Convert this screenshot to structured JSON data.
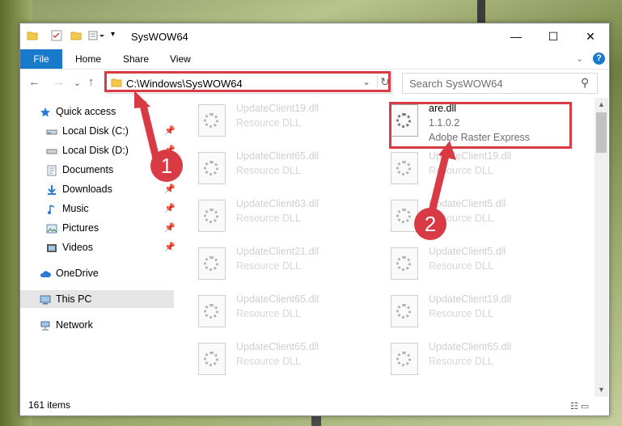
{
  "window": {
    "title": "SysWOW64",
    "minimize_glyph": "—",
    "maximize_glyph": "☐",
    "close_glyph": "✕"
  },
  "ribbon": {
    "tabs": [
      "File",
      "Home",
      "Share",
      "View"
    ],
    "help": "?",
    "collapse": "⌄"
  },
  "nav": {
    "back": "←",
    "forward": "→",
    "recent": "⌄",
    "up": "↑",
    "address": "C:\\Windows\\SysWOW64",
    "address_dropdown": "⌄",
    "refresh": "↻",
    "search_placeholder": "Search SysWOW64",
    "search_icon": "⚲"
  },
  "sidebar": {
    "items": [
      {
        "label": "Quick access",
        "icon": "star-icon",
        "pinned": false
      },
      {
        "label": "Local Disk (C:)",
        "icon": "drive-icon",
        "pinned": true
      },
      {
        "label": "Local Disk (D:)",
        "icon": "drive-icon",
        "pinned": true
      },
      {
        "label": "Documents",
        "icon": "documents-icon",
        "pinned": true
      },
      {
        "label": "Downloads",
        "icon": "download-icon",
        "pinned": true
      },
      {
        "label": "Music",
        "icon": "music-icon",
        "pinned": true
      },
      {
        "label": "Pictures",
        "icon": "pictures-icon",
        "pinned": true
      },
      {
        "label": "Videos",
        "icon": "videos-icon",
        "pinned": true
      },
      {
        "label": "OneDrive",
        "icon": "cloud-icon",
        "pinned": false
      },
      {
        "label": "This PC",
        "icon": "computer-icon",
        "pinned": false,
        "selected": true
      },
      {
        "label": "Network",
        "icon": "network-icon",
        "pinned": false
      }
    ],
    "pin_glyph": "📌"
  },
  "files": {
    "left_column": [
      {
        "name": "UpdateClient19.dll",
        "type": "Resource DLL"
      },
      {
        "name": "UpdateClient65.dll",
        "type": "Resource DLL"
      },
      {
        "name": "UpdateClient63.dll",
        "type": "Resource DLL"
      },
      {
        "name": "UpdateClient21.dll",
        "type": "Resource DLL"
      },
      {
        "name": "UpdateClient65.dll",
        "type": "Resource DLL"
      },
      {
        "name": "UpdateClient65.dll",
        "type": "Resource DLL"
      }
    ],
    "right_column": [
      {
        "name": "are.dll",
        "type": "1.1.0.2",
        "description": "Adobe Raster Express",
        "highlighted": true
      },
      {
        "name": "UpdateClient19.dll",
        "type": "Resource DLL"
      },
      {
        "name": "UpdateClient5.dll",
        "type": "Resource DLL"
      },
      {
        "name": "UpdateClient5.dll",
        "type": "Resource DLL"
      },
      {
        "name": "UpdateClient19.dll",
        "type": "Resource DLL"
      },
      {
        "name": "UpdateClient65.dll",
        "type": "Resource DLL"
      }
    ]
  },
  "status": {
    "item_count": "161 items",
    "view_icons": "☷ ▭"
  },
  "annotations": {
    "step1": "1",
    "step2": "2",
    "color": "#d93b45"
  }
}
